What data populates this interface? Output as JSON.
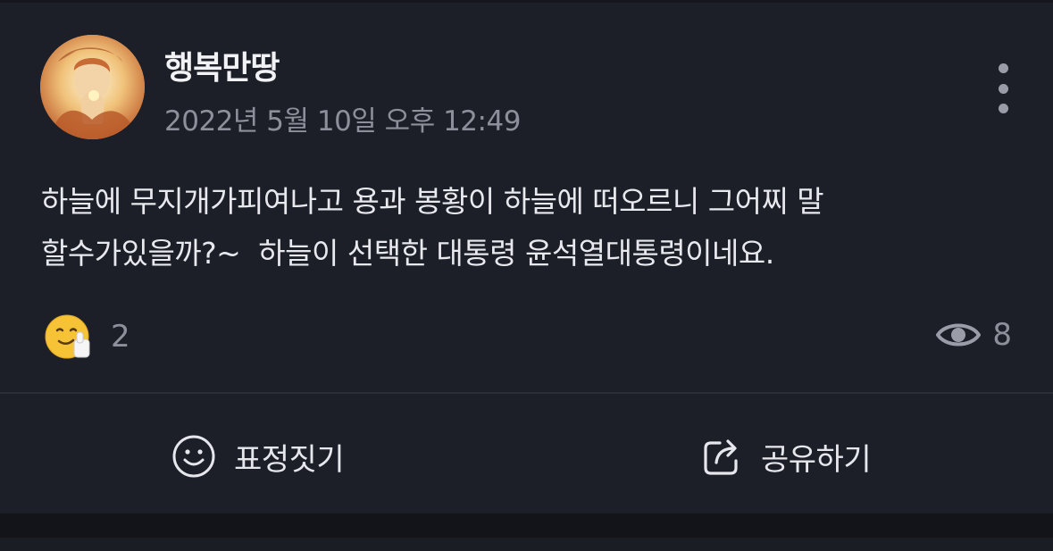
{
  "post": {
    "author": "행복만땅",
    "timestamp": "2022년 5월 10일 오후 12:49",
    "avatar_icon": "avatar-praying-figure",
    "body_lines": [
      "하늘에 무지개가피여나고 용과 봉황이 하늘에 떠오르니 그어찌 말",
      "할수가있을까?~  하늘이 선택한 대통령 윤석열대통령이네요."
    ]
  },
  "stats": {
    "reaction_icon": "thumbs-up-smile-emoji",
    "reaction_count": "2",
    "views_icon": "eye-icon",
    "views_count": "8"
  },
  "actions": {
    "react_label": "표정짓기",
    "react_icon": "smiley-icon",
    "share_label": "공유하기",
    "share_icon": "share-icon"
  },
  "colors": {
    "card_bg": "#1d1f28",
    "page_bg": "#121419",
    "muted_text": "#8d909a",
    "primary_text": "#e8e9ee"
  }
}
